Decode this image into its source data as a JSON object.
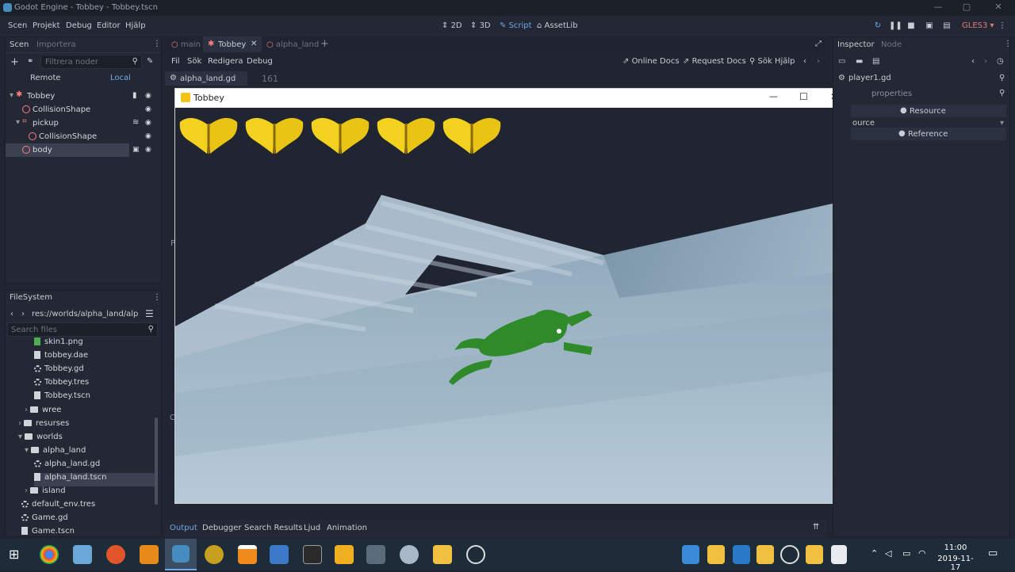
{
  "window": {
    "title": "Godot Engine - Tobbey - Tobbey.tscn"
  },
  "menu": {
    "items": [
      "Scen",
      "Projekt",
      "Debug",
      "Editor",
      "Hjälp"
    ]
  },
  "modes": {
    "m2d": "2D",
    "m3d": "3D",
    "script": "Script",
    "assetlib": "AssetLib"
  },
  "renderer": "GLES3",
  "scene_panel": {
    "tab_active": "Scen",
    "tab_other": "Importera",
    "filter_placeholder": "Filtrera noder",
    "remote": "Remote",
    "local": "Local",
    "tree": [
      {
        "label": "Tobbey",
        "depth": 0
      },
      {
        "label": "CollisionShape",
        "depth": 1
      },
      {
        "label": "pickup",
        "depth": 1
      },
      {
        "label": "CollisionShape",
        "depth": 2
      },
      {
        "label": "body",
        "depth": 1
      }
    ]
  },
  "filesystem": {
    "tab": "FileSystem",
    "path": "res://worlds/alpha_land/alpha_l",
    "search_placeholder": "Search files",
    "items": [
      {
        "label": "skin1.png",
        "kind": "image"
      },
      {
        "label": "tobbey.dae",
        "kind": "file"
      },
      {
        "label": "Tobbey.gd",
        "kind": "script"
      },
      {
        "label": "Tobbey.tres",
        "kind": "resource"
      },
      {
        "label": "Tobbey.tscn",
        "kind": "file"
      },
      {
        "label": "wree",
        "kind": "folder"
      },
      {
        "label": "resurses",
        "kind": "folder"
      },
      {
        "label": "worlds",
        "kind": "folder"
      },
      {
        "label": "alpha_land",
        "kind": "folder"
      },
      {
        "label": "alpha_land.gd",
        "kind": "script"
      },
      {
        "label": "alpha_land.tscn",
        "kind": "file"
      },
      {
        "label": "island",
        "kind": "folder"
      },
      {
        "label": "default_env.tres",
        "kind": "resource"
      },
      {
        "label": "Game.gd",
        "kind": "script"
      },
      {
        "label": "Game.tscn",
        "kind": "file"
      }
    ]
  },
  "scene_tabs": [
    "main",
    "Tobbey",
    "alpha_land"
  ],
  "script_menu": {
    "items": [
      "Fil",
      "Sök",
      "Redigera",
      "Debug"
    ],
    "online_docs": "Online Docs",
    "request_docs": "Request Docs",
    "search_help": "Sök Hjälp"
  },
  "script_file": "alpha_land.gd",
  "line_number": "161",
  "inspector": {
    "tab": "Inspector",
    "tab_other": "Node",
    "object": "player1.gd",
    "filter": "properties",
    "resource": "Resource",
    "source": "ource",
    "reference": "Reference"
  },
  "game_window": {
    "title": "Tobbey",
    "butterflies": 5
  },
  "bottom_tabs": [
    "Output",
    "Debugger",
    "Search Results",
    "Ljud",
    "Animation"
  ],
  "taskbar": {
    "time": "11:00",
    "date": "2019-11-17"
  }
}
